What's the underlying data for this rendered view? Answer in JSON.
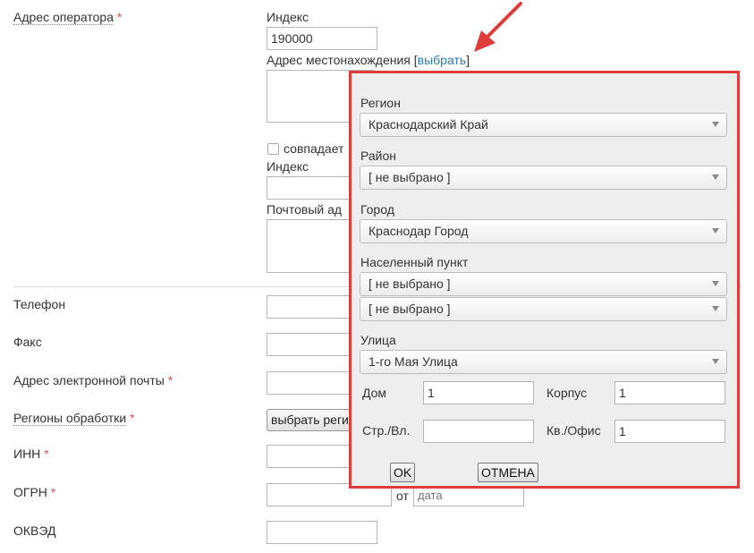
{
  "form": {
    "operator_address_label": "Адрес оператора",
    "required_mark": "*",
    "index_label": "Индекс",
    "index_value": "190000",
    "location_address_label": "Адрес местонахождения",
    "bracket_open": "[",
    "select_link": "выбрать",
    "bracket_close": "]",
    "matches_label": "совпадает",
    "index2_label": "Индекс",
    "postal_address_label": "Почтовый ад",
    "phone_label": "Телефон",
    "fax_label": "Факс",
    "email_label": "Адрес электронной почты",
    "regions_label": "Регионы обработки",
    "select_regions_button": "выбрать реги",
    "inn_label": "ИНН",
    "ogrn_label": "ОГРН",
    "ogrn_from_label": "от",
    "date_placeholder": "дата",
    "okved_label": "ОКВЭД"
  },
  "popup": {
    "region_label": "Регион",
    "region_value": "Краснодарский Край",
    "district_label": "Район",
    "district_value": "[ не выбрано ]",
    "city_label": "Город",
    "city_value": "Краснодар Город",
    "settlement_label": "Населенный пункт",
    "settlement_value_1": "[ не выбрано ]",
    "settlement_value_2": "[ не выбрано ]",
    "street_label": "Улица",
    "street_value": "1-го Мая Улица",
    "house_label": "Дом",
    "house_value": "1",
    "building_label": "Корпус",
    "building_value": "1",
    "structure_label": "Стр./Вл.",
    "structure_value": "",
    "apartment_label": "Кв./Офис",
    "apartment_value": "1",
    "ok_button": "OK",
    "cancel_button": "ОТМЕНА"
  },
  "colors": {
    "accent_border": "#e03c3c",
    "link": "#2a7ab8",
    "required": "#d9534f"
  }
}
